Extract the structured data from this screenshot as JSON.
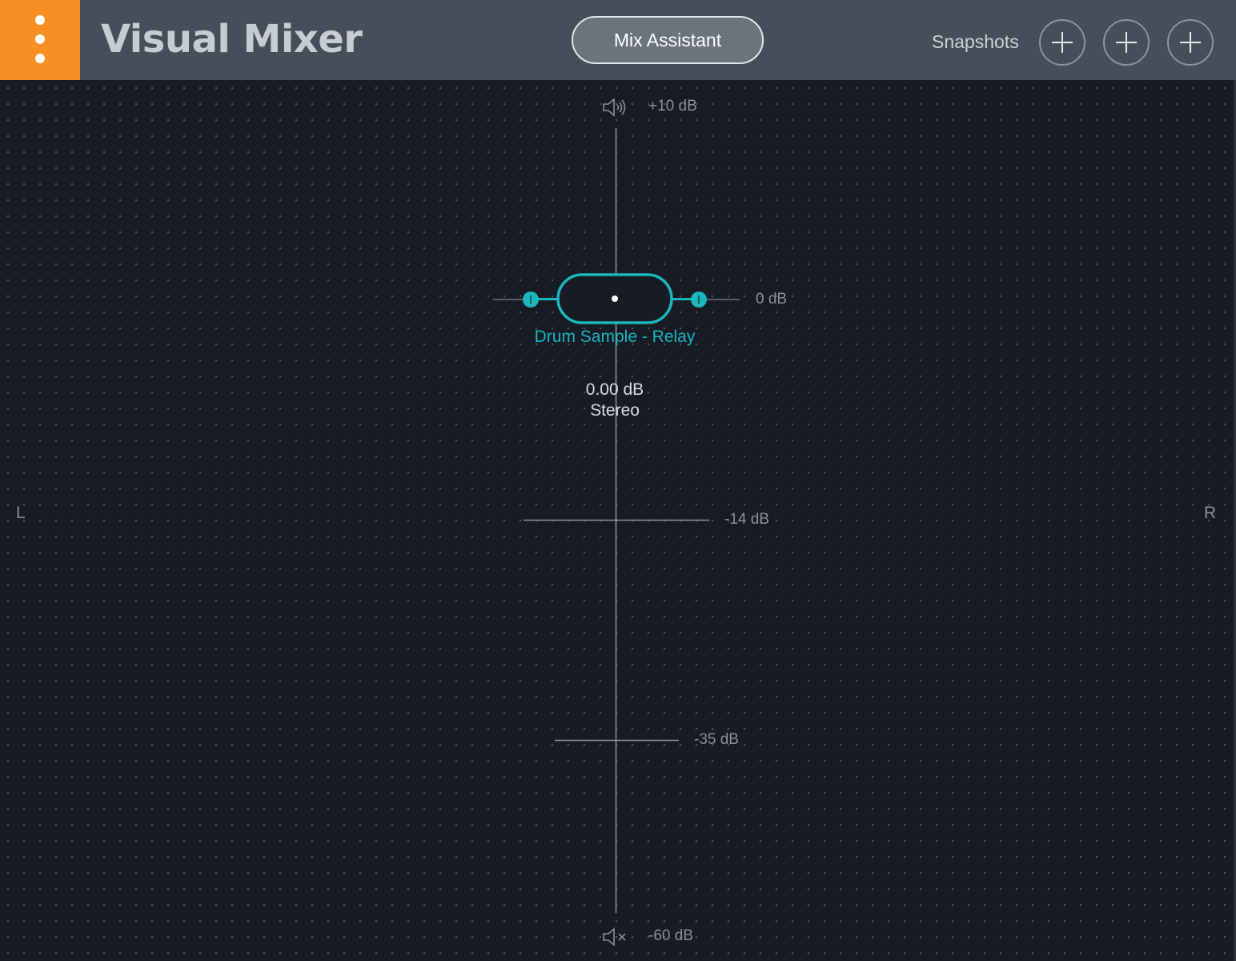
{
  "header": {
    "title": "Visual Mixer",
    "mix_assistant_label": "Mix Assistant",
    "snapshots_label": "Snapshots",
    "menu_icon": "vertical-ellipsis-icon",
    "snapshot_buttons": [
      "plus-icon",
      "plus-icon",
      "plus-icon"
    ]
  },
  "mixer": {
    "gain_scale": {
      "top_label": "+10 dB",
      "zero_label": "0 dB",
      "mid_label": "-14 dB",
      "low_label": "-35 dB",
      "bottom_label": "-60 dB",
      "top_icon": "speaker-loud-icon",
      "bottom_icon": "speaker-mute-icon"
    },
    "pan": {
      "left_label": "L",
      "right_label": "R"
    },
    "track": {
      "name": "Drum Sample - Relay",
      "gain": "0.00 dB",
      "width_mode": "Stereo"
    }
  },
  "colors": {
    "accent_orange": "#f78f22",
    "track_teal": "#1cb6bd",
    "header_bg": "#454e59",
    "stage_bg": "#171b23"
  }
}
